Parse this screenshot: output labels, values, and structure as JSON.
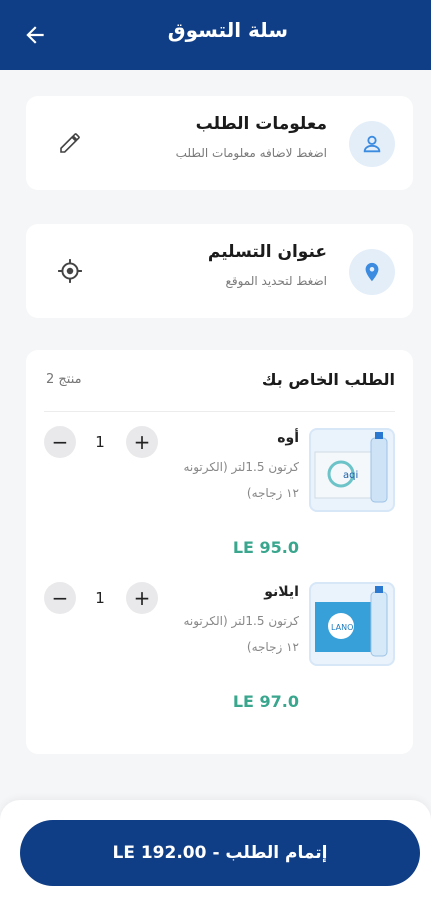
{
  "header": {
    "title": "سلة التسوق"
  },
  "order_info": {
    "title": "معلومات الطلب",
    "subtitle": "اضغط لاضافه معلومات الطلب"
  },
  "delivery": {
    "title": "عنوان التسليم",
    "subtitle": "اضغط لتحديد الموقع"
  },
  "order": {
    "title": "الطلب الخاص بك",
    "count": "منتج 2",
    "items": [
      {
        "name": "أوه",
        "desc": "كرتون 1.5لتر (الكرتونه ١٢ زجاجه)",
        "price": "LE 95.0",
        "qty": "1",
        "img_label": "aqi"
      },
      {
        "name": "ايلانو",
        "desc": "كرتون 1.5لتر (الكرتونه ١٢ زجاجه)",
        "price": "LE 97.0",
        "qty": "1",
        "img_label": "LANO"
      }
    ]
  },
  "checkout": {
    "label": "إتمام الطلب -",
    "total": "LE 192.00"
  },
  "colors": {
    "primary": "#0f3d86",
    "price": "#39a68d",
    "icon_bg": "#e3eef9",
    "icon": "#3b8be0"
  }
}
